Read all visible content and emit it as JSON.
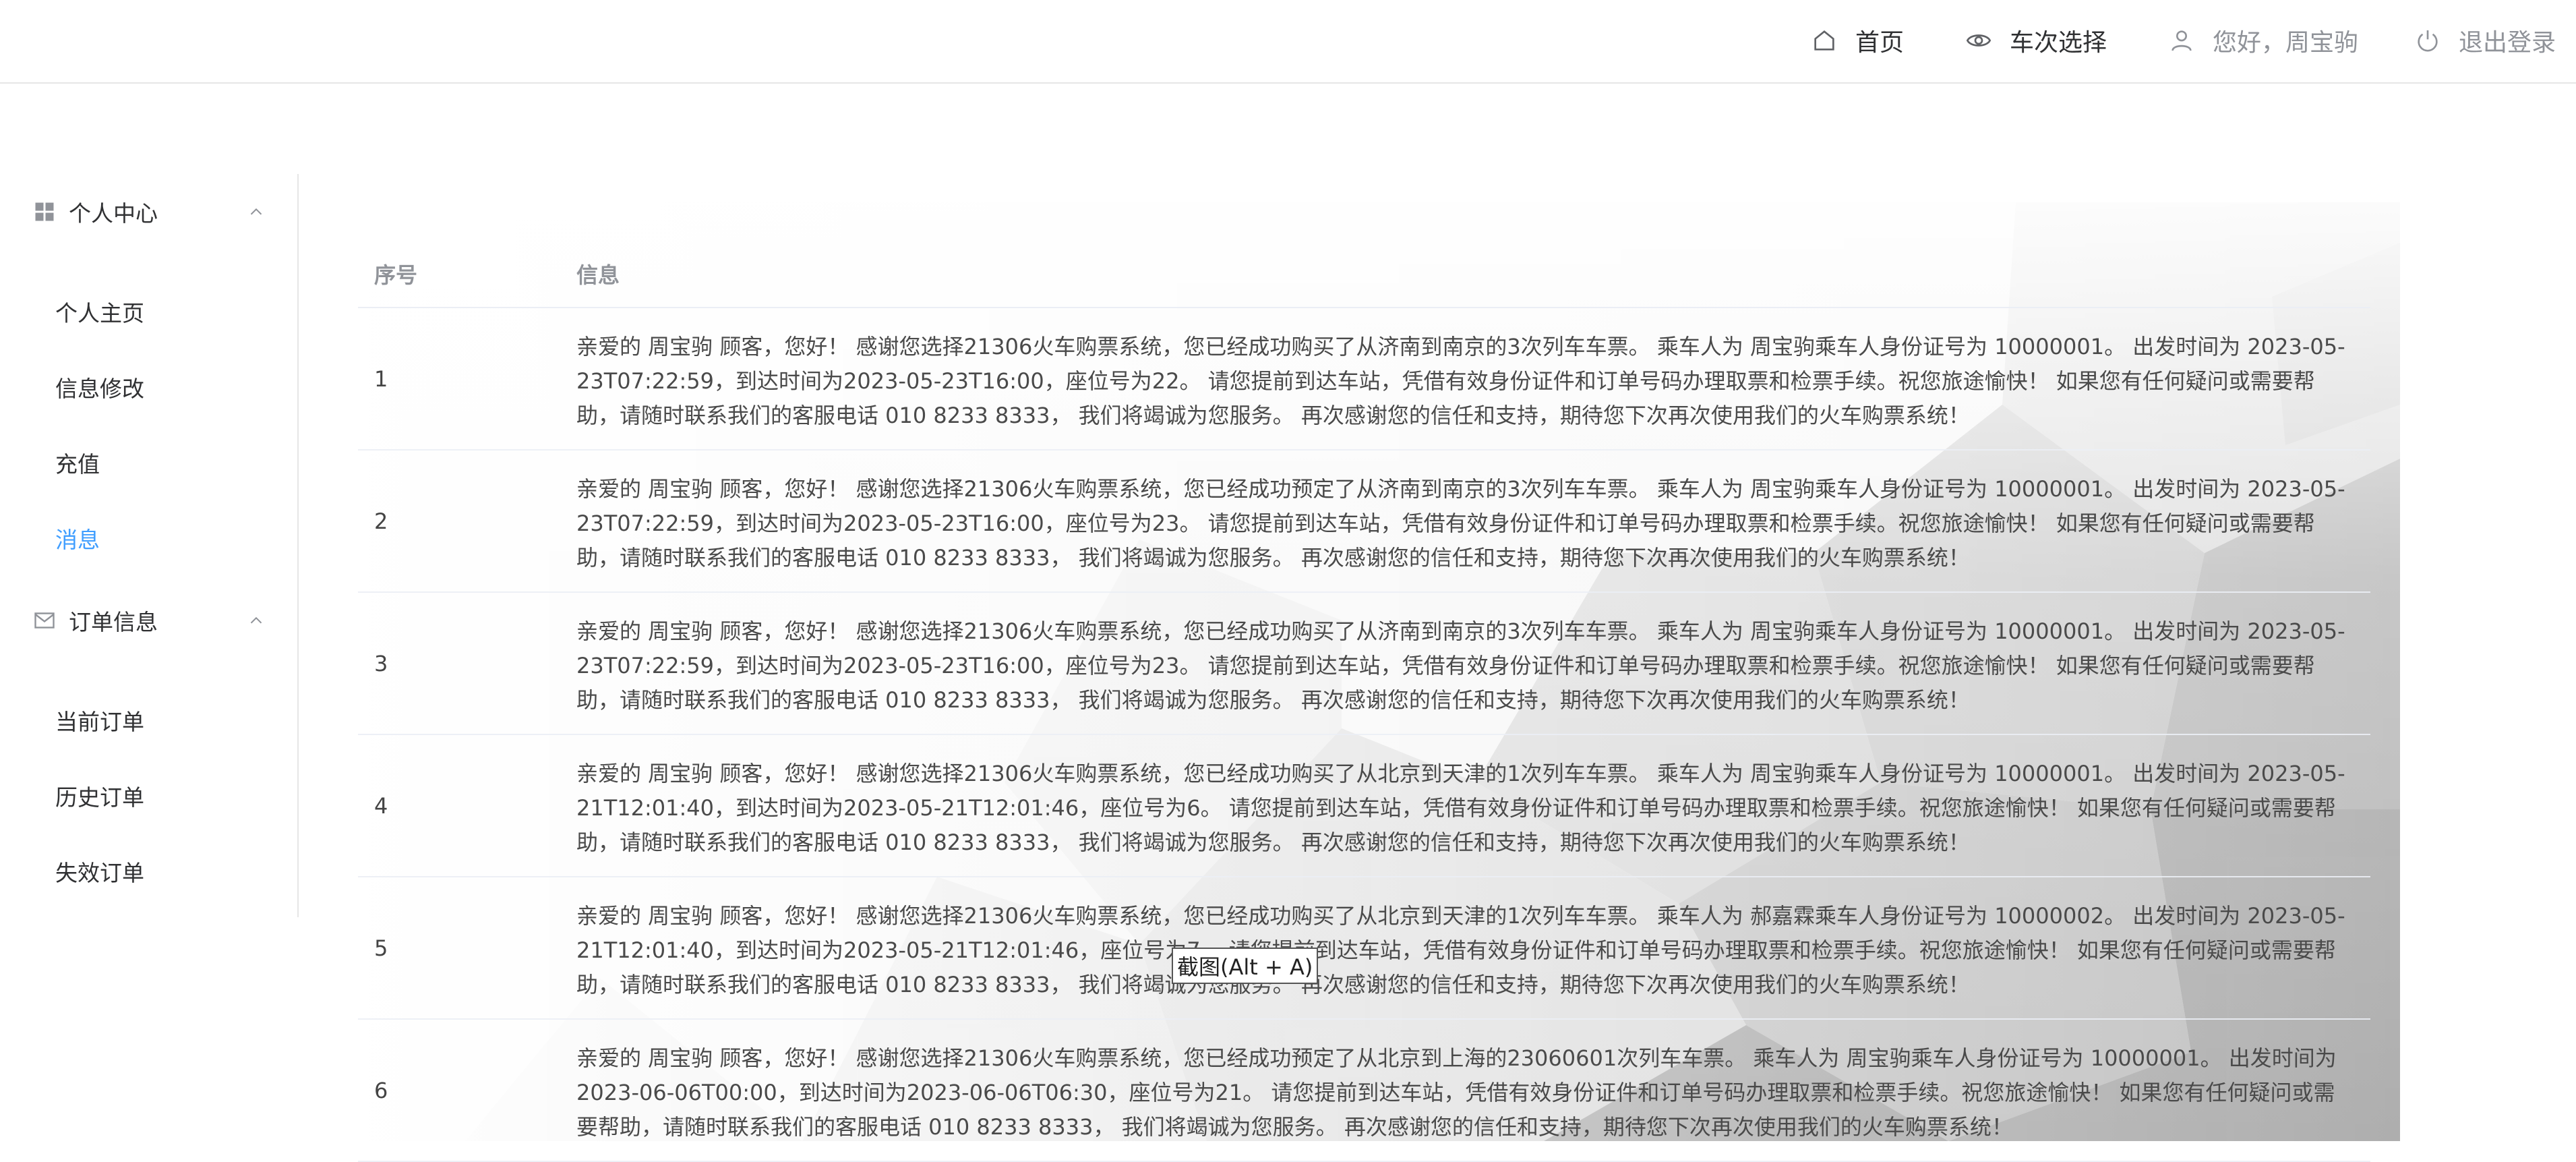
{
  "header": {
    "nav": [
      {
        "label": "首页",
        "icon": "home-icon"
      },
      {
        "label": "车次选择",
        "icon": "eye-icon"
      },
      {
        "label": "您好，周宝驹",
        "icon": "user-icon"
      },
      {
        "label": "退出登录",
        "icon": "power-icon"
      }
    ]
  },
  "sidebar": {
    "groups": [
      {
        "title": "个人中心",
        "icon": "grid-icon",
        "items": [
          {
            "label": "个人主页"
          },
          {
            "label": "信息修改"
          },
          {
            "label": "充值"
          },
          {
            "label": "消息",
            "active": true
          }
        ]
      },
      {
        "title": "订单信息",
        "icon": "mail-icon",
        "items": [
          {
            "label": "当前订单"
          },
          {
            "label": "历史订单"
          },
          {
            "label": "失效订单"
          }
        ]
      }
    ]
  },
  "table": {
    "columns": [
      "序号",
      "信息"
    ],
    "rows": [
      {
        "idx": "1",
        "msg": "亲爱的 周宝驹 顾客，您好！ 感谢您选择21306火车购票系统，您已经成功购买了从济南到南京的3次列车车票。 乘车人为 周宝驹乘车人身份证号为 10000001。 出发时间为 2023-05-23T07:22:59，到达时间为2023-05-23T16:00，座位号为22。 请您提前到达车站，凭借有效身份证件和订单号码办理取票和检票手续。祝您旅途愉快！ 如果您有任何疑问或需要帮助，请随时联系我们的客服电话 010 8233 8333， 我们将竭诚为您服务。 再次感谢您的信任和支持，期待您下次再次使用我们的火车购票系统！"
      },
      {
        "idx": "2",
        "msg": "亲爱的 周宝驹 顾客，您好！ 感谢您选择21306火车购票系统，您已经成功预定了从济南到南京的3次列车车票。 乘车人为 周宝驹乘车人身份证号为 10000001。 出发时间为 2023-05-23T07:22:59，到达时间为2023-05-23T16:00，座位号为23。 请您提前到达车站，凭借有效身份证件和订单号码办理取票和检票手续。祝您旅途愉快！ 如果您有任何疑问或需要帮助，请随时联系我们的客服电话 010 8233 8333， 我们将竭诚为您服务。 再次感谢您的信任和支持，期待您下次再次使用我们的火车购票系统！"
      },
      {
        "idx": "3",
        "msg": "亲爱的 周宝驹 顾客，您好！ 感谢您选择21306火车购票系统，您已经成功购买了从济南到南京的3次列车车票。 乘车人为 周宝驹乘车人身份证号为 10000001。 出发时间为 2023-05-23T07:22:59，到达时间为2023-05-23T16:00，座位号为23。 请您提前到达车站，凭借有效身份证件和订单号码办理取票和检票手续。祝您旅途愉快！ 如果您有任何疑问或需要帮助，请随时联系我们的客服电话 010 8233 8333， 我们将竭诚为您服务。 再次感谢您的信任和支持，期待您下次再次使用我们的火车购票系统！"
      },
      {
        "idx": "4",
        "msg": "亲爱的 周宝驹 顾客，您好！ 感谢您选择21306火车购票系统，您已经成功购买了从北京到天津的1次列车车票。 乘车人为 周宝驹乘车人身份证号为 10000001。 出发时间为 2023-05-21T12:01:40，到达时间为2023-05-21T12:01:46，座位号为6。 请您提前到达车站，凭借有效身份证件和订单号码办理取票和检票手续。祝您旅途愉快！ 如果您有任何疑问或需要帮助，请随时联系我们的客服电话 010 8233 8333， 我们将竭诚为您服务。 再次感谢您的信任和支持，期待您下次再次使用我们的火车购票系统！"
      },
      {
        "idx": "5",
        "msg": "亲爱的 周宝驹 顾客，您好！ 感谢您选择21306火车购票系统，您已经成功购买了从北京到天津的1次列车车票。 乘车人为 郝嘉霖乘车人身份证号为 10000002。 出发时间为 2023-05-21T12:01:40，到达时间为2023-05-21T12:01:46，座位号为7。 请您提前到达车站，凭借有效身份证件和订单号码办理取票和检票手续。祝您旅途愉快！ 如果您有任何疑问或需要帮助，请随时联系我们的客服电话 010 8233 8333， 我们将竭诚为您服务。 再次感谢您的信任和支持，期待您下次再次使用我们的火车购票系统！"
      },
      {
        "idx": "6",
        "msg": "亲爱的 周宝驹 顾客，您好！ 感谢您选择21306火车购票系统，您已经成功预定了从北京到上海的23060601次列车车票。 乘车人为 周宝驹乘车人身份证号为 10000001。 出发时间为 2023-06-06T00:00，到达时间为2023-06-06T06:30，座位号为21。 请您提前到达车站，凭借有效身份证件和订单号码办理取票和检票手续。祝您旅途愉快！ 如果您有任何疑问或需要帮助，请随时联系我们的客服电话 010 8233 8333， 我们将竭诚为您服务。 再次感谢您的信任和支持，期待您下次再次使用我们的火车购票系统！"
      }
    ]
  },
  "tooltip": {
    "text": "截图(Alt + A)"
  },
  "colors": {
    "accent": "#409eff",
    "border": "#e6e6e6",
    "text": "#303133",
    "muted": "#909399"
  }
}
